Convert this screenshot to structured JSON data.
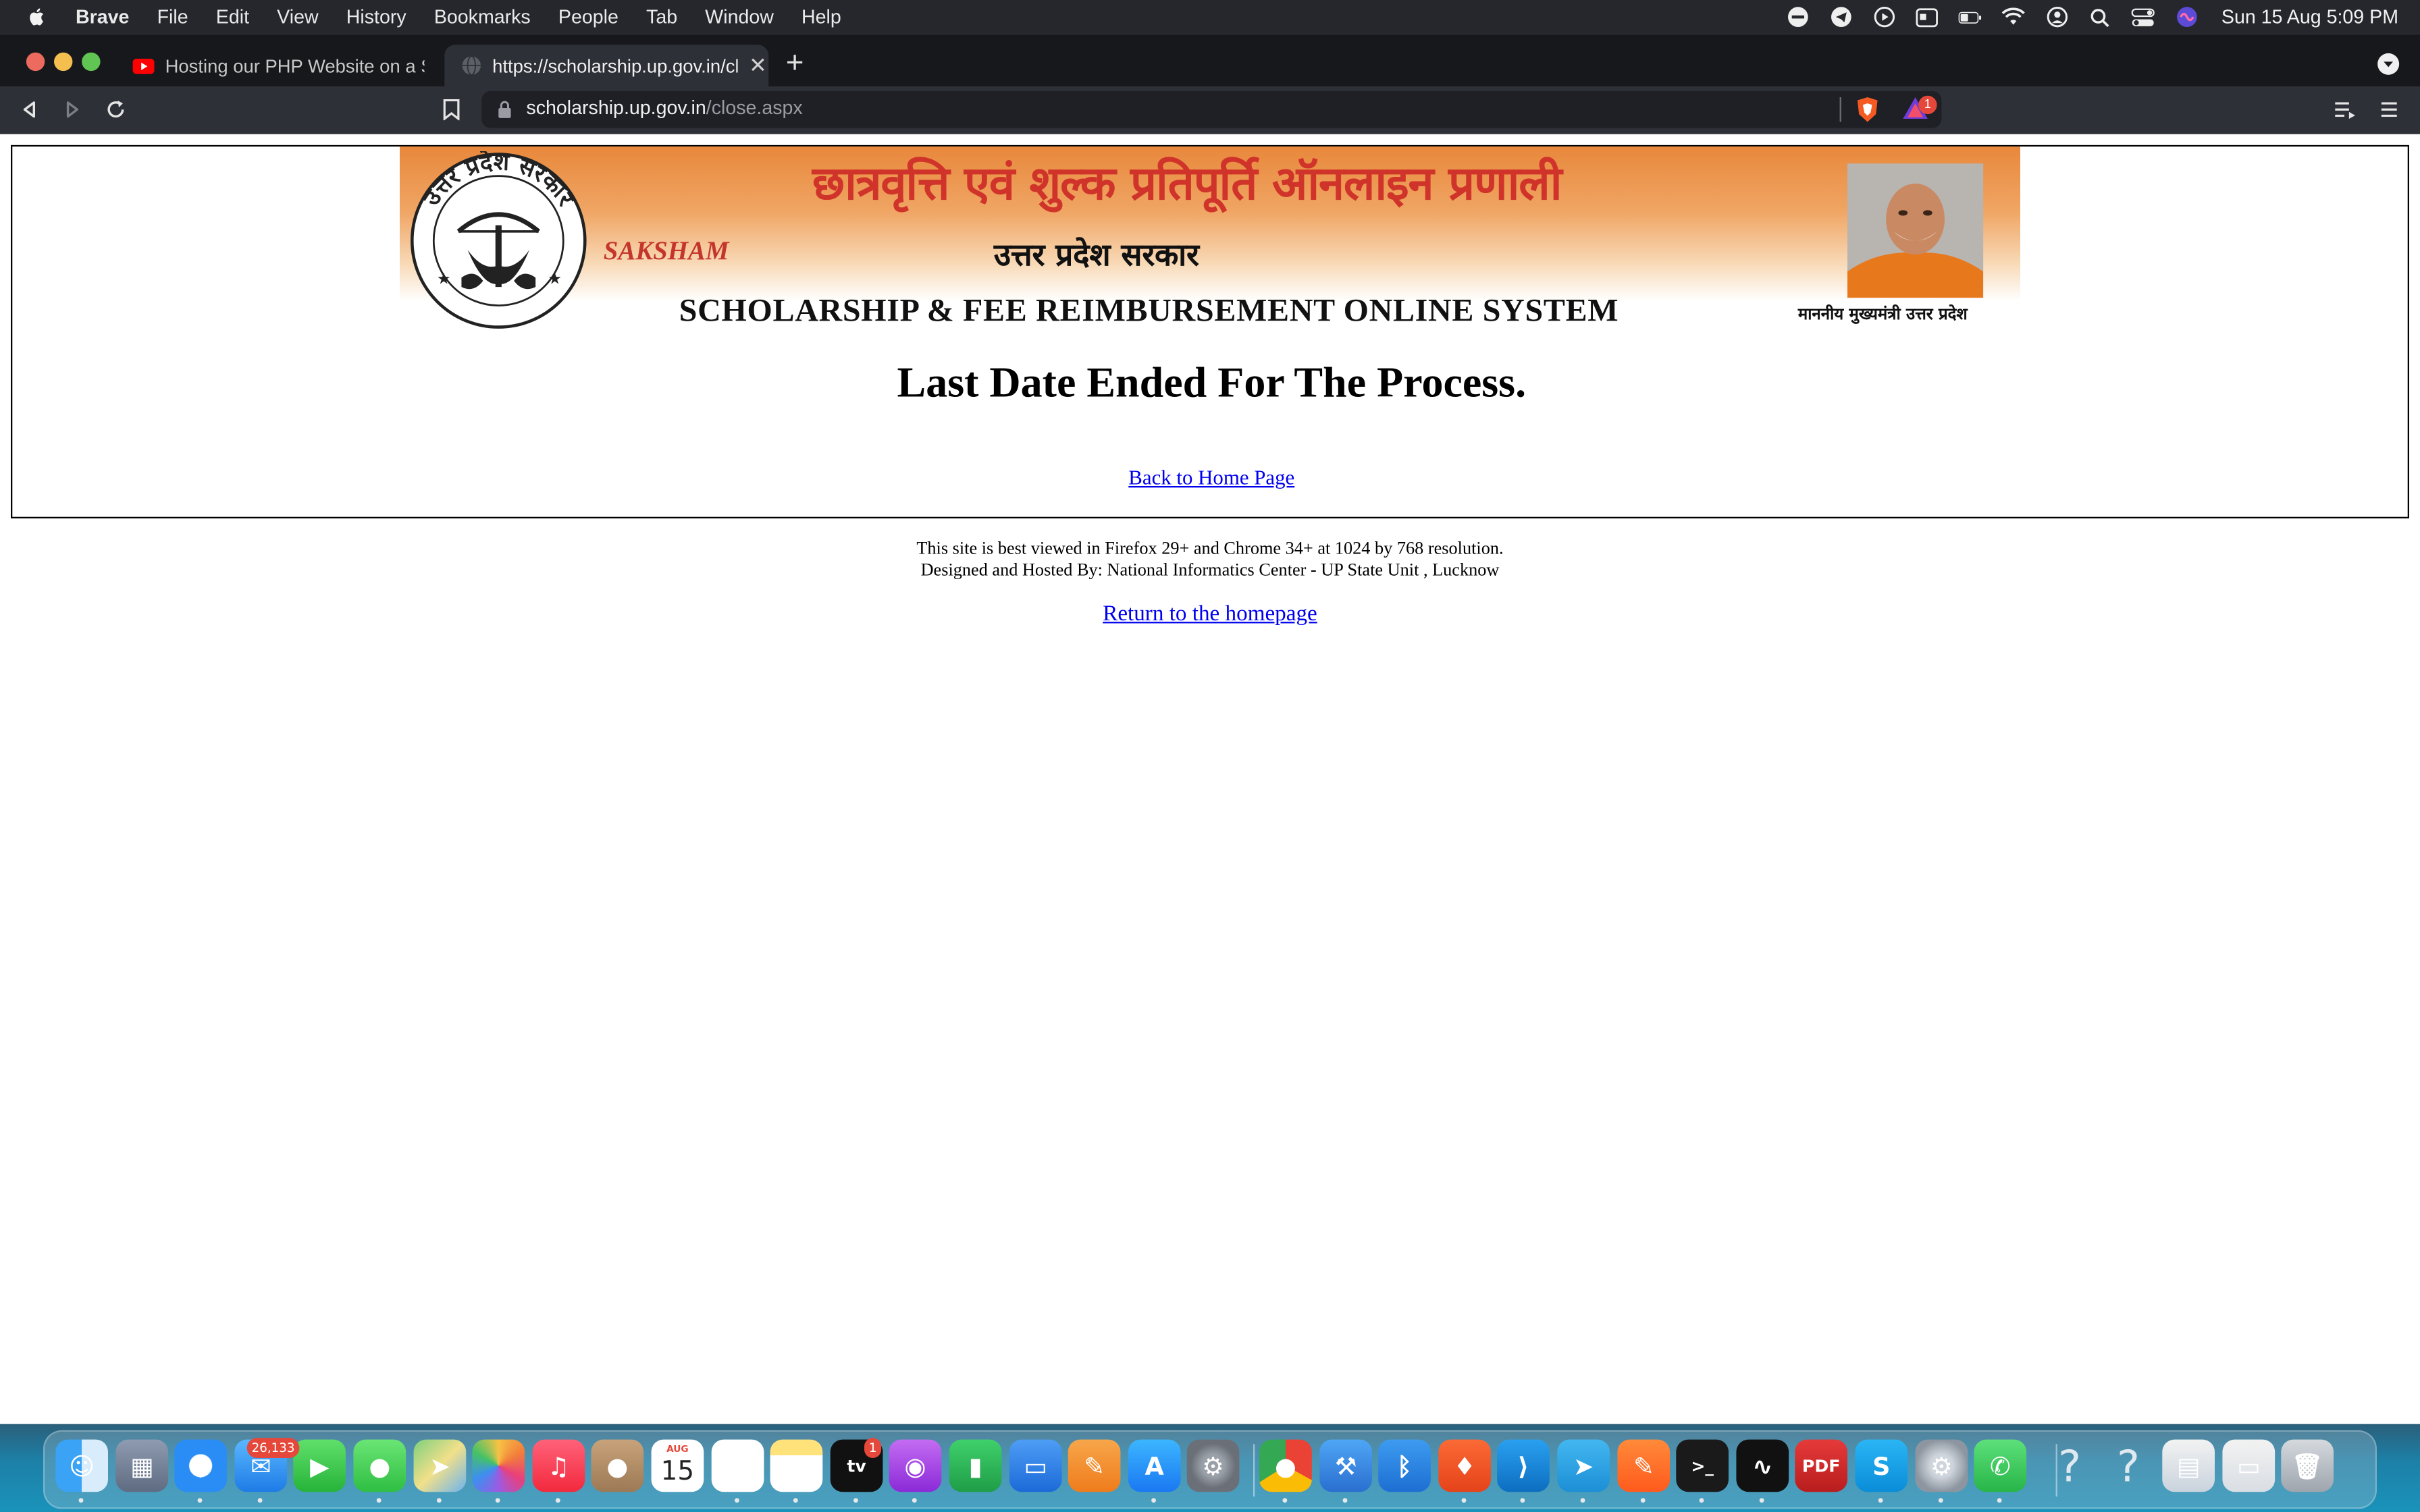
{
  "menubar": {
    "app_name": "Brave",
    "items": [
      "File",
      "Edit",
      "View",
      "History",
      "Bookmarks",
      "People",
      "Tab",
      "Window",
      "Help"
    ],
    "clock": "Sun 15 Aug  5:09 PM"
  },
  "tabs": [
    {
      "title": "Hosting our PHP Website on a Server",
      "icon": "youtube-icon",
      "active": false
    },
    {
      "title": "https://scholarship.up.gov.in/close.aspx",
      "icon": "globe-icon",
      "active": true
    }
  ],
  "address_bar": {
    "host": "scholarship.up.gov.in",
    "path": "/close.aspx",
    "rewards_badge": "1"
  },
  "page": {
    "banner": {
      "hindi_title": "छात्रवृत्ति एवं शुल्क प्रतिपूर्ति ऑनलाइन प्रणाली",
      "saksham": "SAKSHAM",
      "hindi_subtitle": "उत्तर प्रदेश सरकार",
      "english_title": "SCHOLARSHIP & FEE REIMBURSEMENT ONLINE SYSTEM",
      "emblem_text": "उत्तर प्रदेश सरकार",
      "cm_caption": "माननीय मुख्यमंत्री  उत्तर प्रदेश"
    },
    "heading": "Last Date Ended For The Process.",
    "back_link": "Back to Home Page",
    "footer_line1": "This site is best viewed in Firefox 29+ and Chrome 34+ at 1024 by 768 resolution.",
    "footer_line2": "Designed and Hosted By: National Informatics Center - UP State Unit , Lucknow",
    "return_link": "Return to the homepage"
  },
  "dock": {
    "mail_badge": "26,133",
    "tv_badge": "1",
    "calendar_month": "AUG",
    "calendar_day": "15",
    "apps": [
      "finder-icon",
      "launchpad-icon",
      "safari-icon",
      "mail-icon",
      "facetime-icon",
      "messages-icon",
      "maps-icon",
      "photos-icon",
      "music-icon",
      "contacts-icon",
      "calendar-icon",
      "reminders-icon",
      "notes-icon",
      "appletv-icon",
      "podcasts-icon",
      "numbers-icon",
      "keynote-icon",
      "pages-icon",
      "appstore-icon",
      "system-preferences-icon",
      "chrome-icon",
      "xcode-icon",
      "bluetooth-icon",
      "brave-icon",
      "vscode-icon",
      "telegram-icon",
      "sketch-icon",
      "terminal-icon",
      "activity-monitor-icon",
      "pdf-reader-icon",
      "skype-icon",
      "utility-icon",
      "whatsapp-icon",
      "unknown-app-icon",
      "unknown-app-icon",
      "preview-icon",
      "screenshot-icon",
      "trash-icon"
    ]
  },
  "colors": {
    "menubar_bg": "#25272c",
    "tabstrip_bg": "#17181c",
    "toolbar_bg": "#2e3038",
    "link": "#0000ee",
    "banner_title_red": "#d0332a",
    "banner_orange": "#e8883c"
  }
}
